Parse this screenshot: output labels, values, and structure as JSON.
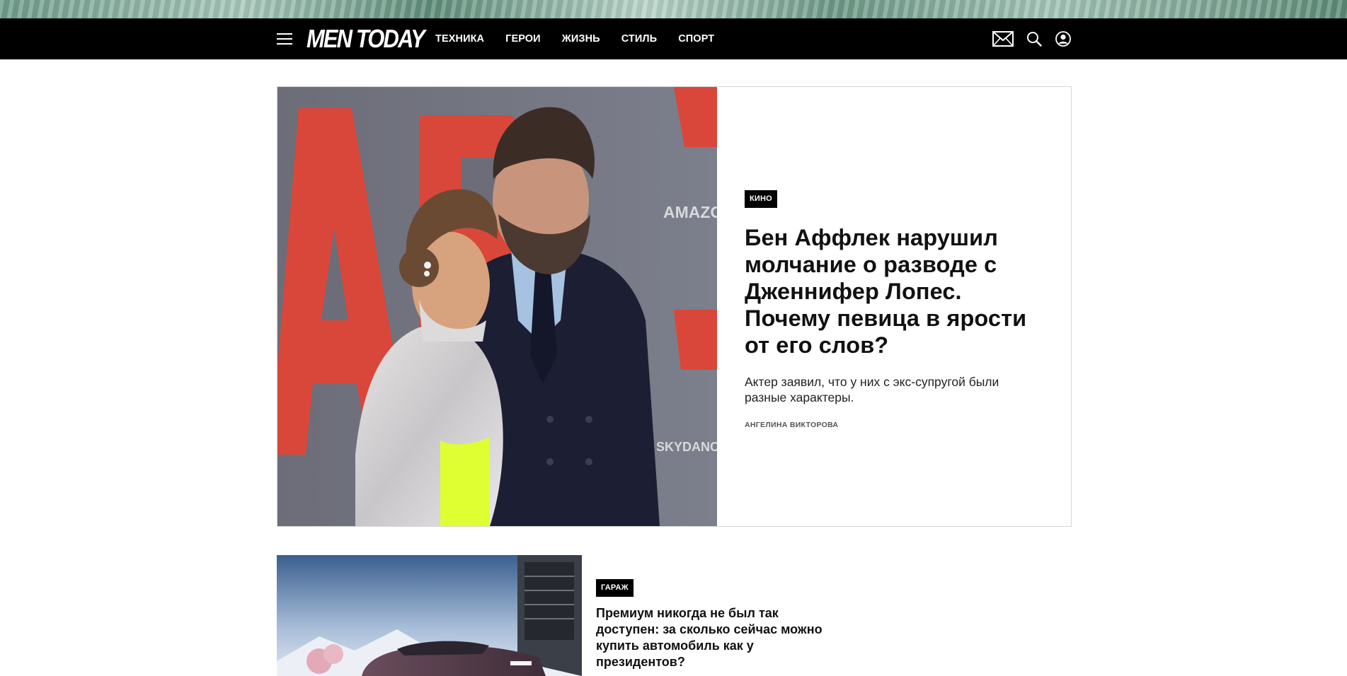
{
  "header": {
    "logo": "MEN TODAY",
    "nav": [
      "ТЕХНИКА",
      "ГЕРОИ",
      "ЖИЗНЬ",
      "СТИЛЬ",
      "СПОРТ"
    ],
    "icons": [
      "menu-icon",
      "mail-icon",
      "search-icon",
      "user-icon"
    ]
  },
  "hero": {
    "tag": "КИНО",
    "title": "Бен Аффлек нарушил молчание о разводе с Дженнифер Лопес. Почему певица в ярости от его слов?",
    "lead": "Актер заявил, что у них с экс-супругой были разные характеры.",
    "author": "АНГЕЛИНА ВИКТОРОВА",
    "image_text": [
      "AIR",
      "AMAZON STUDIOS",
      "SKYDANCE"
    ]
  },
  "card2": {
    "tag": "ГАРАЖ",
    "title": "Премиум никогда не был так доступен: за сколько сейчас можно купить автомобиль как у президентов?"
  },
  "colors": {
    "navbar": "#000000",
    "tag_bg": "#000000",
    "text": "#111111"
  }
}
